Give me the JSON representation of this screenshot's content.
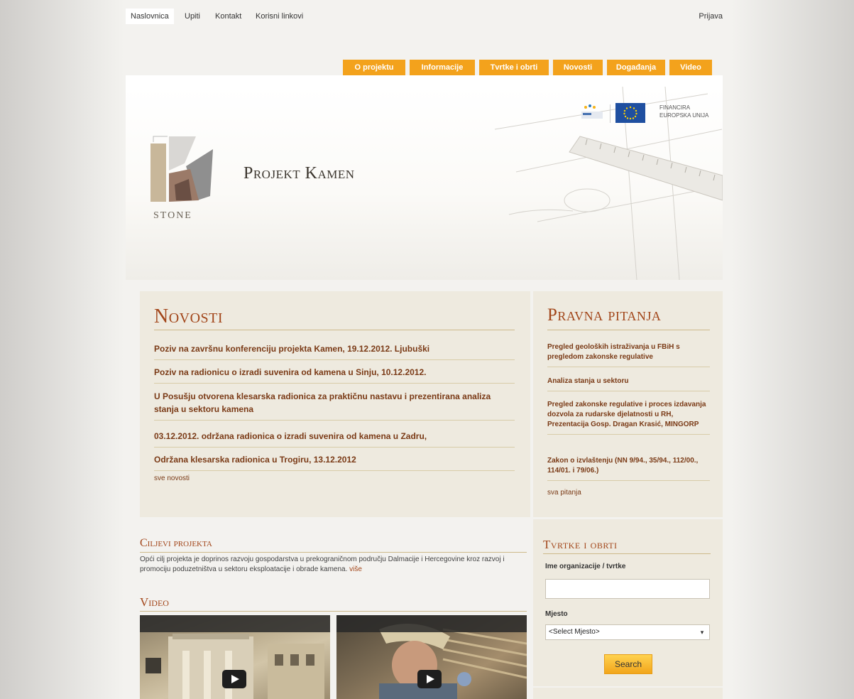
{
  "topnav": {
    "items": [
      "Naslovnica",
      "Upiti",
      "Kontakt",
      "Korisni linkovi"
    ],
    "login": "Prijava"
  },
  "tabs": [
    "O projektu",
    "Informacije",
    "Tvrtke i obrti",
    "Novosti",
    "Događanja",
    "Video"
  ],
  "header": {
    "title": "Projekt Kamen",
    "logo_text": "STONE",
    "eu_text": "FINANCIRA EUROPSKA UNIJA"
  },
  "news": {
    "title": "Novosti",
    "items": [
      "Poziv na završnu konferenciju projekta Kamen, 19.12.2012. Ljubuški",
      "Poziv na radionicu o izradi suvenira od kamena u Sinju, 10.12.2012.",
      "U Posušju otvorena klesarska radionica za praktičnu nastavu i prezentirana analiza stanja u sektoru kamena",
      "03.12.2012. održana radionica o izradi suvenira od kamena u Zadru,",
      "Održana klesarska radionica u Trogiru, 13.12.2012"
    ],
    "more": "sve novosti"
  },
  "legal": {
    "title": "Pravna pitanja",
    "items": [
      "Pregled geoloških istraživanja u FBiH s pregledom zakonske regulative",
      "Analiza stanja u sektoru",
      "Pregled zakonske regulative i proces izdavanja dozvola za rudarske djelatnosti u RH, Prezentacija Gosp. Dragan Krasić, MINGORP",
      "Zakon o izvlaštenju (NN 9/94., 35/94., 112/00., 114/01. i 79/06.)"
    ],
    "more": "sva pitanja"
  },
  "goals": {
    "title": "Ciljevi projekta",
    "text": "Opći cilj projekta je doprinos razvoju gospodarstva u prekograničnom području Dalmacije i Hercegovine kroz razvoj i promociju poduzetništva u sektoru eksploatacije i obrade kamena.",
    "more": "više"
  },
  "video": {
    "title": "Video"
  },
  "firms": {
    "title": "Tvrtke i obrti",
    "org_label": "Ime organizacije / tvrtke",
    "place_label": "Mjesto",
    "place_selected": "<Select Mjesto>",
    "search_label": "Search"
  },
  "colors": {
    "accent_orange": "#f3a21c",
    "heading_brown": "#a2461a",
    "link_brown": "#7a3a16",
    "panel_bg": "#eeeadf"
  }
}
